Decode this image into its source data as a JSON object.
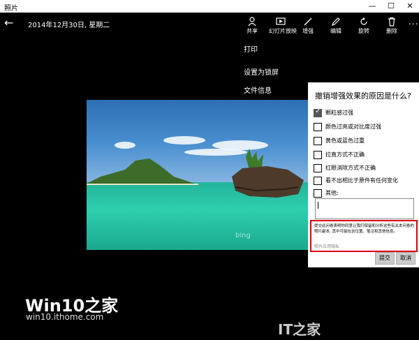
{
  "window": {
    "title": "照片",
    "minimize": "—",
    "maximize": "☐",
    "close": "✕"
  },
  "header": {
    "date": "2014年12月30日, 星期二",
    "more": "..."
  },
  "toolbar": [
    {
      "label": "共享",
      "icon": "share-icon"
    },
    {
      "label": "幻灯片放映",
      "icon": "slideshow-icon"
    },
    {
      "label": "增强",
      "icon": "enhance-wand-icon"
    },
    {
      "label": "编辑",
      "icon": "pencil-edit-icon"
    },
    {
      "label": "旋转",
      "icon": "rotate-icon"
    },
    {
      "label": "删除",
      "icon": "trash-icon"
    }
  ],
  "menu": {
    "print": "打印",
    "lockscreen": "设置为锁屏",
    "fileinfo": "文件信息"
  },
  "feedback": {
    "question": "撤销增强效果的原因是什么?",
    "options": [
      {
        "label": "颗粒感过强",
        "checked": true
      },
      {
        "label": "颜色过亮或对比度过强",
        "checked": false
      },
      {
        "label": "黄色或蓝色过重",
        "checked": false
      },
      {
        "label": "拉直方式不正确",
        "checked": false
      },
      {
        "label": "红眼消除方式不正确",
        "checked": false
      },
      {
        "label": "看不出相比于原件有任何变化",
        "checked": false
      },
      {
        "label": "其他:",
        "checked": false
      }
    ],
    "notice": "提交此问卷表明你同意让我们保留和分析这些有关本问卷的照片副本, 其中可能包含位置、笔注和其他信息。",
    "privacy_link": "照片应用隐私",
    "submit": "提交",
    "cancel": "取消"
  },
  "photo": {
    "watermark": "bing"
  },
  "watermarks": {
    "brand": "Win10之家",
    "url": "win10.ithome.com",
    "right_prefix": "IT之家",
    "right_it": "IT"
  }
}
